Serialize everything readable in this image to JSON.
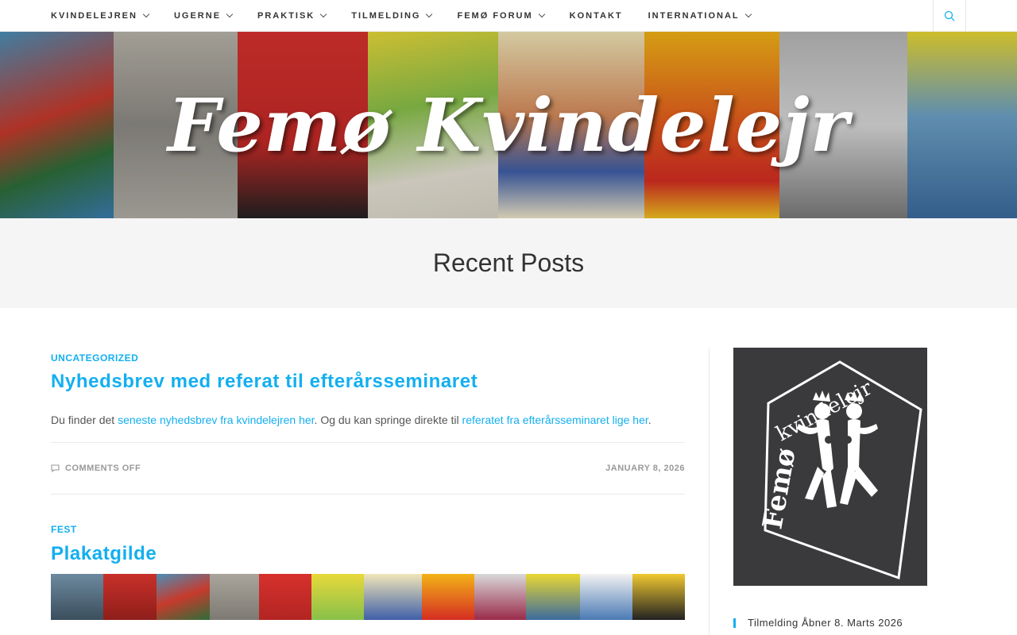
{
  "nav": {
    "items": [
      {
        "label": "KVINDELEJREN",
        "dropdown": true
      },
      {
        "label": "UGERNE",
        "dropdown": true
      },
      {
        "label": "PRAKTISK",
        "dropdown": true
      },
      {
        "label": "TILMELDING",
        "dropdown": true
      },
      {
        "label": "FEMØ FORUM",
        "dropdown": true
      },
      {
        "label": "KONTAKT",
        "dropdown": false
      },
      {
        "label": "INTERNATIONAL",
        "dropdown": true
      }
    ],
    "search_icon": "search-icon"
  },
  "hero": {
    "title": "Femø Kvindelejr"
  },
  "page": {
    "title": "Recent Posts"
  },
  "posts": [
    {
      "category": "UNCATEGORIZED",
      "title": "Nyhedsbrev med referat til efterårsseminaret",
      "excerpt": {
        "text1": "Du finder det ",
        "link1": "seneste nyhedsbrev fra kvindelejren her",
        "text2": ". Og du kan springe direkte til ",
        "link2": "referatet fra efterårsseminaret lige her",
        "text3": "."
      },
      "comments": "COMMENTS OFF",
      "date": "JANUARY 8, 2026"
    },
    {
      "category": "FEST",
      "title": "Plakatgilde"
    }
  ],
  "sidebar": {
    "logo_text_top": "kvindelejr",
    "logo_text_side": "Femø",
    "link": "Tilmelding Åbner 8. Marts 2026"
  },
  "colors": {
    "accent": "#13aff0",
    "header_bg": "#f5f5f5",
    "logo_bg": "#3a3a3c"
  }
}
